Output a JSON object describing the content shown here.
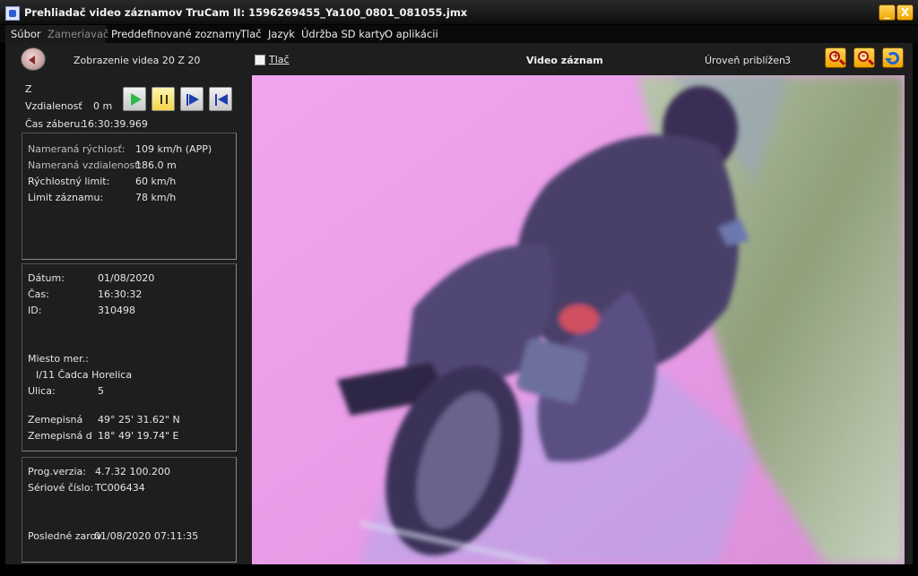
{
  "window": {
    "title": "Prehliadač video záznamov TruCam II:  1596269455_Ya100_0801_081055.jmx",
    "minimize_glyph": "_",
    "close_glyph": "X",
    "accent_color": "#f0a500"
  },
  "menu": [
    {
      "label": "Súbor",
      "enabled": true
    },
    {
      "label": "Zameriavač",
      "enabled": false
    },
    {
      "label": "Preddefinované zoznamy",
      "enabled": true
    },
    {
      "label": "Tlač",
      "enabled": true
    },
    {
      "label": "Jazyk",
      "enabled": true
    },
    {
      "label": "Údržba SD karty",
      "enabled": true
    },
    {
      "label": "O aplikácii",
      "enabled": true
    }
  ],
  "playback": {
    "frame_label": "Zobrazenie videa 20 Z 20",
    "hidden_z_label": "Z",
    "distance_label": "Vzdialenosť",
    "distance_value": "0 m",
    "capture_time_label": "Čas záberu:",
    "capture_time_value": "16:30:39.969",
    "icons": [
      "back-icon",
      "play-icon",
      "pause-icon",
      "next-frame-icon",
      "first-frame-icon"
    ]
  },
  "measurement": {
    "speed_label": "Nameraná rýchlosť:",
    "speed_value": "109 km/h (APP)",
    "distance_label": "Nameraná vzdialenosť:",
    "distance_value": "186.0 m",
    "limit_label": "Rýchlostný limit:",
    "limit_value": "60 km/h",
    "record_limit_label": "Limit záznamu:",
    "record_limit_value": "78 km/h"
  },
  "record": {
    "date_label": "Dátum:",
    "date_value": "01/08/2020",
    "time_label": "Čas:",
    "time_value": "16:30:32",
    "id_label": "ID:",
    "id_value": "310498",
    "place_label": "Miesto mer.:",
    "place_value": "I/11 Čadca Horelica",
    "street_label": "Ulica:",
    "street_value": "5",
    "lat_label": "Zemepisná",
    "lat_value": "49° 25' 31.62\" N",
    "lon_label": "Zemepisná d",
    "lon_value": "18° 49' 19.74\" E"
  },
  "device": {
    "version_label": "Prog.verzia:",
    "version_value": "4.7.32  100.200",
    "serial_label": "Sériové číslo:",
    "serial_value": "TC006434",
    "last_label": "Posledné zarov",
    "last_value": "01/08/2020  07:11:35"
  },
  "viewer": {
    "print_label": "Tlač",
    "video_title": "Video záznam",
    "zoom_label": "Úroveň priblížen",
    "zoom_value": "3",
    "zoom_in_glyph": "+",
    "zoom_out_glyph": "-",
    "tools": [
      "zoom-in-icon",
      "zoom-out-icon",
      "reset-zoom-icon"
    ]
  }
}
